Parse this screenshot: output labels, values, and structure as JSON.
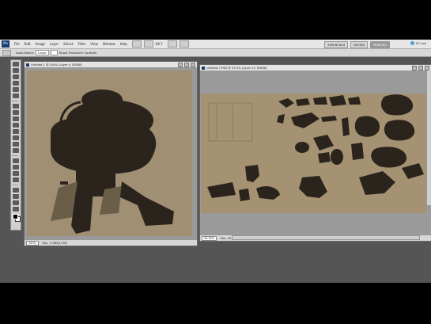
{
  "app": {
    "logo": "Ps"
  },
  "menu": [
    "File",
    "Edit",
    "Image",
    "Layer",
    "Select",
    "Filter",
    "View",
    "Window",
    "Help"
  ],
  "menubar_controls": [
    "br-icon",
    "mb-icon",
    "arrange-icon",
    "screen-mode-icon"
  ],
  "menubar_zoom": "66.7",
  "workspaces": [
    {
      "label": "ESSENTIALS",
      "active": false
    },
    {
      "label": "DESIGN",
      "active": false
    },
    {
      "label": "PAINTING",
      "active": true
    }
  ],
  "cs_live": "CS Live",
  "options": {
    "tool_preset": "",
    "auto_select_label": "Auto-Select:",
    "auto_select_value": "Layer",
    "show_transform_label": "Show Transform Controls"
  },
  "left_doc": {
    "title": "Untitled-1 @ 100% (Layer 0, RGB/8)",
    "zoom": "100%",
    "doc_size": "Doc: 3.78M/3.03M",
    "canvas_color": "#a08f72"
  },
  "right_doc": {
    "title": "Untitled-7.PSD @ 33.3% (Layer 25, RGB/8)",
    "zoom": "33.33%",
    "doc_size": "Doc: 20.0M/10.5M",
    "canvas_color": "#a49273"
  },
  "colors": {
    "foreground": "#000000",
    "background": "#ffffff",
    "shape": "#2b241d"
  }
}
